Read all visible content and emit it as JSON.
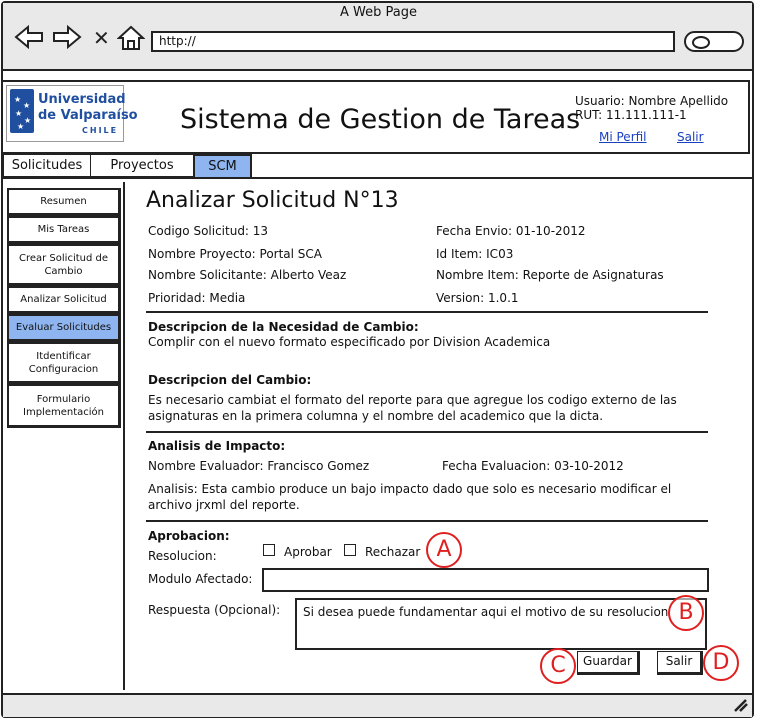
{
  "browser": {
    "window_title": "A Web Page",
    "url": "http://"
  },
  "header": {
    "logo": {
      "line1": "Universidad",
      "line2": "de Valparaíso",
      "line3": "CHILE"
    },
    "app_title": "Sistema de Gestion de Tareas",
    "user_label": "Usuario: Nombre Apellido",
    "rut_label": "RUT: 11.111.111-1",
    "profile_link": "Mi Perfil",
    "logout_link": "Salir"
  },
  "tabs": [
    {
      "label": "Solicitudes",
      "selected": false
    },
    {
      "label": "Proyectos",
      "selected": false
    },
    {
      "label": "SCM",
      "selected": true
    }
  ],
  "sidebar": {
    "items": [
      {
        "label": "Resumen",
        "selected": false
      },
      {
        "label": "Mis Tareas",
        "selected": false
      },
      {
        "label": "Crear Solicitud de Cambio",
        "selected": false
      },
      {
        "label": "Analizar Solicitud",
        "selected": false
      },
      {
        "label": "Evaluar Solicitudes",
        "selected": true
      },
      {
        "label": "Itdentificar Configuracion",
        "selected": false
      },
      {
        "label": "Formulario Implementación",
        "selected": false
      }
    ]
  },
  "main": {
    "page_title": "Analizar Solicitud N°13",
    "codigo": "Codigo Solicitud: 13",
    "fecha_envio": "Fecha Envio: 01-10-2012",
    "nombre_proyecto": "Nombre Proyecto: Portal SCA",
    "id_item": "Id Item: IC03",
    "nombre_solicitante": "Nombre Solicitante: Alberto Veaz",
    "nombre_item": "Nombre Item: Reporte de Asignaturas",
    "prioridad": "Prioridad: Media",
    "version": "Version: 1.0.1",
    "necesidad_heading": "Descripcion de la Necesidad de Cambio:",
    "necesidad_text": "Complir con el nuevo formato especificado por Division Academica",
    "cambio_heading": "Descripcion del Cambio:",
    "cambio_line1": "Es necesario cambiat el formato del reporte para que agregue los codigo externo de las",
    "cambio_line2": "asignaturas en la primera columna y el nombre del academico que la dicta.",
    "impacto_heading": "Analisis de Impacto:",
    "evaluador": "Nombre Evaluador: Francisco Gomez",
    "fecha_evaluacion": "Fecha Evaluacion: 03-10-2012",
    "analisis_line1": "Analisis: Esta cambio produce un bajo impacto dado que solo es necesario modificar el",
    "analisis_line2": "archivo jrxml del reporte.",
    "aprobacion_heading": "Aprobacion:",
    "resolucion_label": "Resolucion:",
    "aprobar_label": "Aprobar",
    "rechazar_label": "Rechazar",
    "modulo_label": "Modulo Afectado:",
    "modulo_value": "",
    "respuesta_label": "Respuesta (Opcional):",
    "respuesta_placeholder": "Si desea puede fundamentar aqui el motivo de su resolucion",
    "guardar_label": "Guardar",
    "salir_label": "Salir"
  },
  "markers": {
    "a": "A",
    "b": "B",
    "c": "C",
    "d": "D"
  },
  "colors": {
    "selected": "#8fb5f0",
    "marker": "#e02020",
    "link": "#1a3fbf",
    "brand": "#1f4f9e"
  }
}
